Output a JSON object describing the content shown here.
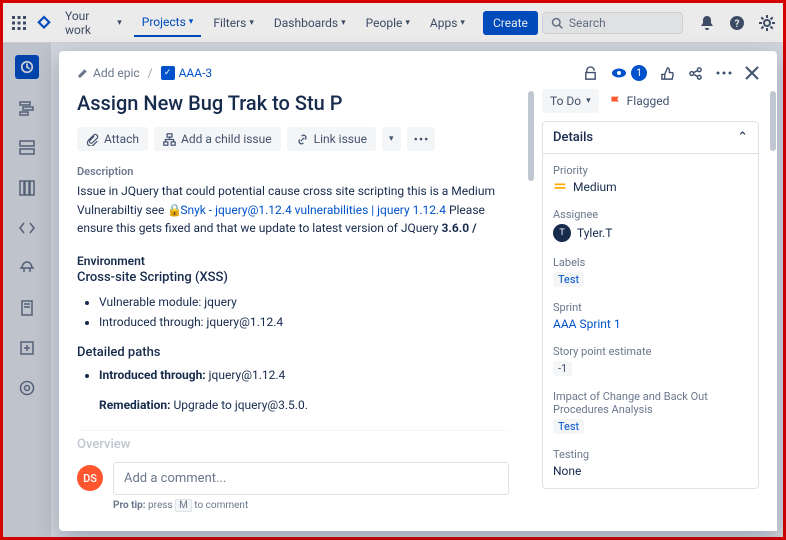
{
  "topnav": {
    "items": [
      "Your work",
      "Projects",
      "Filters",
      "Dashboards",
      "People",
      "Apps"
    ],
    "active_index": 1,
    "create": "Create",
    "search_placeholder": "Search"
  },
  "breadcrumb": {
    "add_epic": "Add epic",
    "issue_key": "AAA-3"
  },
  "header_actions": {
    "watch_count": "1"
  },
  "issue": {
    "title": "Assign New Bug Trak to Stu P",
    "toolbar": {
      "attach": "Attach",
      "child": "Add a child issue",
      "link": "Link issue"
    },
    "description_label": "Description",
    "description_pre": "Issue in JQuery that could potential cause cross site scripting this is a Medium Vulnerabiltiy see ",
    "description_link": "Snyk - jquery@1.12.4 vulnerabilities | jquery 1.12.4",
    "description_post": " Please ensure this gets fixed and that we update to latest version of JQuery ",
    "description_bold": "3.6.0 /",
    "env_label": "Environment",
    "env_title": "Cross-site Scripting (XSS)",
    "env_items": [
      "Vulnerable module: jquery",
      "Introduced through: jquery@1.12.4"
    ],
    "paths_label": "Detailed paths",
    "path_intro_label": "Introduced through: ",
    "path_intro_val": "jquery@1.12.4",
    "remediation_label": "Remediation: ",
    "remediation_val": "Upgrade to jquery@3.5.0.",
    "overview_label": "Overview"
  },
  "comment": {
    "author_initials": "DS",
    "placeholder": "Add a comment...",
    "protip_pre": "Pro tip: ",
    "protip_press": "press ",
    "protip_key": "M",
    "protip_post": " to comment"
  },
  "side": {
    "status": "To Do",
    "flagged": "Flagged",
    "details_header": "Details",
    "fields": {
      "priority": {
        "label": "Priority",
        "value": "Medium"
      },
      "assignee": {
        "label": "Assignee",
        "value": "Tyler.T",
        "initial": "T"
      },
      "labels": {
        "label": "Labels",
        "value": "Test"
      },
      "sprint": {
        "label": "Sprint",
        "value": "AAA Sprint 1"
      },
      "estimate": {
        "label": "Story point estimate",
        "value": "-1"
      },
      "impact": {
        "label": "Impact of Change and Back Out Procedures Analysis",
        "value": "Test"
      },
      "testing": {
        "label": "Testing",
        "value": "None"
      }
    }
  }
}
